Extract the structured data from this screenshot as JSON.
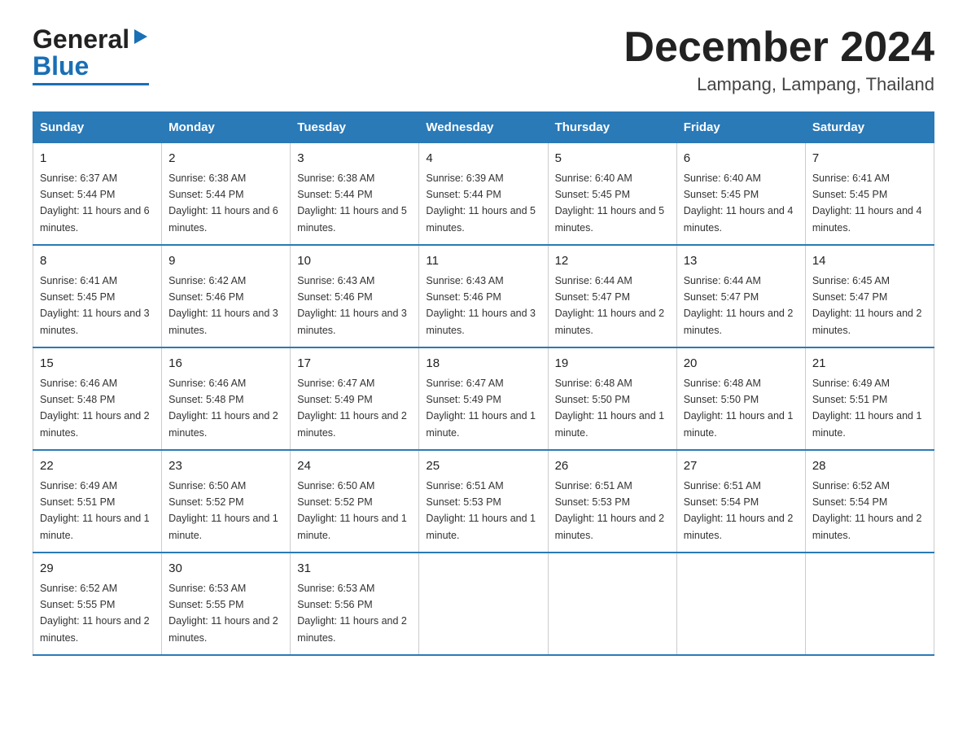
{
  "logo": {
    "text_general": "General",
    "text_blue": "Blue",
    "triangle": "▶"
  },
  "header": {
    "month": "December 2024",
    "location": "Lampang, Lampang, Thailand"
  },
  "days_of_week": [
    "Sunday",
    "Monday",
    "Tuesday",
    "Wednesday",
    "Thursday",
    "Friday",
    "Saturday"
  ],
  "weeks": [
    [
      {
        "day": "1",
        "sunrise": "6:37 AM",
        "sunset": "5:44 PM",
        "daylight": "11 hours and 6 minutes."
      },
      {
        "day": "2",
        "sunrise": "6:38 AM",
        "sunset": "5:44 PM",
        "daylight": "11 hours and 6 minutes."
      },
      {
        "day": "3",
        "sunrise": "6:38 AM",
        "sunset": "5:44 PM",
        "daylight": "11 hours and 5 minutes."
      },
      {
        "day": "4",
        "sunrise": "6:39 AM",
        "sunset": "5:44 PM",
        "daylight": "11 hours and 5 minutes."
      },
      {
        "day": "5",
        "sunrise": "6:40 AM",
        "sunset": "5:45 PM",
        "daylight": "11 hours and 5 minutes."
      },
      {
        "day": "6",
        "sunrise": "6:40 AM",
        "sunset": "5:45 PM",
        "daylight": "11 hours and 4 minutes."
      },
      {
        "day": "7",
        "sunrise": "6:41 AM",
        "sunset": "5:45 PM",
        "daylight": "11 hours and 4 minutes."
      }
    ],
    [
      {
        "day": "8",
        "sunrise": "6:41 AM",
        "sunset": "5:45 PM",
        "daylight": "11 hours and 3 minutes."
      },
      {
        "day": "9",
        "sunrise": "6:42 AM",
        "sunset": "5:46 PM",
        "daylight": "11 hours and 3 minutes."
      },
      {
        "day": "10",
        "sunrise": "6:43 AM",
        "sunset": "5:46 PM",
        "daylight": "11 hours and 3 minutes."
      },
      {
        "day": "11",
        "sunrise": "6:43 AM",
        "sunset": "5:46 PM",
        "daylight": "11 hours and 3 minutes."
      },
      {
        "day": "12",
        "sunrise": "6:44 AM",
        "sunset": "5:47 PM",
        "daylight": "11 hours and 2 minutes."
      },
      {
        "day": "13",
        "sunrise": "6:44 AM",
        "sunset": "5:47 PM",
        "daylight": "11 hours and 2 minutes."
      },
      {
        "day": "14",
        "sunrise": "6:45 AM",
        "sunset": "5:47 PM",
        "daylight": "11 hours and 2 minutes."
      }
    ],
    [
      {
        "day": "15",
        "sunrise": "6:46 AM",
        "sunset": "5:48 PM",
        "daylight": "11 hours and 2 minutes."
      },
      {
        "day": "16",
        "sunrise": "6:46 AM",
        "sunset": "5:48 PM",
        "daylight": "11 hours and 2 minutes."
      },
      {
        "day": "17",
        "sunrise": "6:47 AM",
        "sunset": "5:49 PM",
        "daylight": "11 hours and 2 minutes."
      },
      {
        "day": "18",
        "sunrise": "6:47 AM",
        "sunset": "5:49 PM",
        "daylight": "11 hours and 1 minute."
      },
      {
        "day": "19",
        "sunrise": "6:48 AM",
        "sunset": "5:50 PM",
        "daylight": "11 hours and 1 minute."
      },
      {
        "day": "20",
        "sunrise": "6:48 AM",
        "sunset": "5:50 PM",
        "daylight": "11 hours and 1 minute."
      },
      {
        "day": "21",
        "sunrise": "6:49 AM",
        "sunset": "5:51 PM",
        "daylight": "11 hours and 1 minute."
      }
    ],
    [
      {
        "day": "22",
        "sunrise": "6:49 AM",
        "sunset": "5:51 PM",
        "daylight": "11 hours and 1 minute."
      },
      {
        "day": "23",
        "sunrise": "6:50 AM",
        "sunset": "5:52 PM",
        "daylight": "11 hours and 1 minute."
      },
      {
        "day": "24",
        "sunrise": "6:50 AM",
        "sunset": "5:52 PM",
        "daylight": "11 hours and 1 minute."
      },
      {
        "day": "25",
        "sunrise": "6:51 AM",
        "sunset": "5:53 PM",
        "daylight": "11 hours and 1 minute."
      },
      {
        "day": "26",
        "sunrise": "6:51 AM",
        "sunset": "5:53 PM",
        "daylight": "11 hours and 2 minutes."
      },
      {
        "day": "27",
        "sunrise": "6:51 AM",
        "sunset": "5:54 PM",
        "daylight": "11 hours and 2 minutes."
      },
      {
        "day": "28",
        "sunrise": "6:52 AM",
        "sunset": "5:54 PM",
        "daylight": "11 hours and 2 minutes."
      }
    ],
    [
      {
        "day": "29",
        "sunrise": "6:52 AM",
        "sunset": "5:55 PM",
        "daylight": "11 hours and 2 minutes."
      },
      {
        "day": "30",
        "sunrise": "6:53 AM",
        "sunset": "5:55 PM",
        "daylight": "11 hours and 2 minutes."
      },
      {
        "day": "31",
        "sunrise": "6:53 AM",
        "sunset": "5:56 PM",
        "daylight": "11 hours and 2 minutes."
      },
      null,
      null,
      null,
      null
    ]
  ]
}
